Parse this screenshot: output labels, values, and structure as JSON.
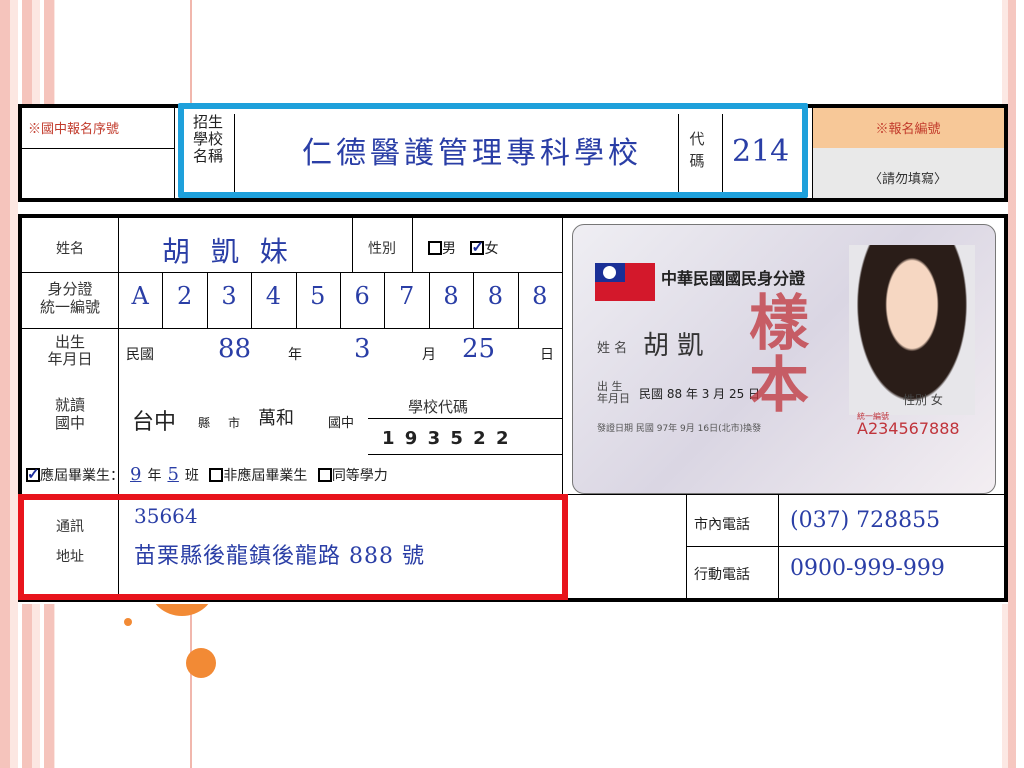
{
  "header": {
    "jh_seq_label": "※國中報名序號",
    "school_label": [
      "招生",
      "學校",
      "名稱"
    ],
    "school_name": "仁德醫護管理專科學校",
    "code_label": [
      "代",
      "碼"
    ],
    "code": "214",
    "reg_no_label": "※報名編號",
    "reg_no_note": "〈請勿填寫〉"
  },
  "form": {
    "name_label": "姓名",
    "name_value": "胡 凱 妹",
    "gender_label": "性別",
    "gender_male": "男",
    "gender_female": "女",
    "id_label": [
      "身分證",
      "統一編號"
    ],
    "id_digits": [
      "A",
      "2",
      "3",
      "4",
      "5",
      "6",
      "7",
      "8",
      "8",
      "8"
    ],
    "birth_label": [
      "出生",
      "年月日"
    ],
    "birth_era": "民國",
    "birth_year": "88",
    "birth_year_unit": "年",
    "birth_month": "3",
    "birth_month_unit": "月",
    "birth_day": "25",
    "birth_day_unit": "日",
    "school_attend_label": [
      "就讀",
      "國中"
    ],
    "city": "台中",
    "county_unit": "縣",
    "city_unit": "市",
    "jh_name": "萬和",
    "jh_unit": "國中",
    "school_code_label": "學校代碼",
    "school_code": "1 9 3 5 2 2",
    "grad_current": "應屆畢業生：",
    "grad_year": "9",
    "grad_year_unit": "年",
    "grad_class": "5",
    "grad_class_unit": "班",
    "grad_non_current": "非應屆畢業生",
    "grad_equiv": "同等學力",
    "address_label": [
      "通訊",
      "地址"
    ],
    "zip": "35664",
    "address": "苗栗縣後龍鎮後龍路 888 號",
    "phone_label": "市內電話",
    "phone": "(037) 728855",
    "mobile_label": "行動電話",
    "mobile": "0900-999-999"
  },
  "id_card": {
    "title": "中華民國國民身分證",
    "name_label": "姓 名",
    "name_value": "胡 凱",
    "birth_label": [
      "出 生",
      "年月日"
    ],
    "birth_value": "民國 88 年 3 月 25 日",
    "gender": "性別 女",
    "issue": "發證日期 民國 97年 9月 16日(北市)換發",
    "unified_id_label": "統一編號",
    "id_no": "A234567888",
    "stamp": "樣本"
  },
  "colors": {
    "school_box": "#1ea0db",
    "highlight_box": "#e8141c",
    "handwriting": "#2a3ea6"
  }
}
